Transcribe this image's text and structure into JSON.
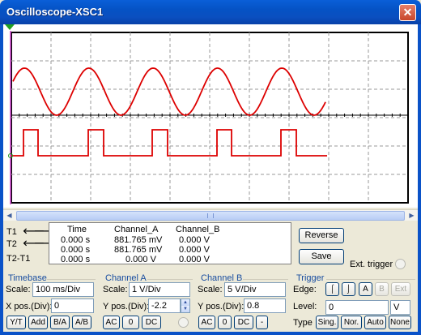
{
  "window": {
    "title": "Oscilloscope-XSC1",
    "close_label": "✕"
  },
  "screen": {
    "channel_a_color": "#dd0000",
    "channel_b_color": "#dd0000",
    "cursor1_color": "#d040d0",
    "cursor2_color": "#2020c0"
  },
  "readout": {
    "headers": {
      "time": "Time",
      "a": "Channel_A",
      "b": "Channel_B"
    },
    "rows": [
      {
        "label": "T1",
        "time": "0.000 s",
        "a": "881.765 mV",
        "b": "0.000 V"
      },
      {
        "label": "T2",
        "time": "0.000 s",
        "a": "881.765 mV",
        "b": "0.000 V"
      },
      {
        "label": "T2-T1",
        "time": "0.000 s",
        "a": "0.000 V",
        "b": "0.000 V"
      }
    ]
  },
  "buttons": {
    "reverse": "Reverse",
    "save": "Save",
    "ext_trigger": "Ext. trigger"
  },
  "timebase": {
    "title": "Timebase",
    "scale_label": "Scale:",
    "scale_value": "100 ms/Div",
    "xpos_label": "X pos.(Div):",
    "xpos_value": "0",
    "modes": [
      "Y/T",
      "Add",
      "B/A",
      "A/B"
    ]
  },
  "channel_a": {
    "title": "Channel A",
    "scale_label": "Scale:",
    "scale_value": "1  V/Div",
    "ypos_label": "Y pos.(Div):",
    "ypos_value": "-2.2",
    "coupling": [
      "AC",
      "0",
      "DC"
    ]
  },
  "channel_b": {
    "title": "Channel B",
    "scale_label": "Scale:",
    "scale_value": "5  V/Div",
    "ypos_label": "Y pos.(Div):",
    "ypos_value": "0.8",
    "coupling": [
      "AC",
      "0",
      "DC",
      "-"
    ]
  },
  "trigger": {
    "title": "Trigger",
    "edge_label": "Edge:",
    "level_label": "Level:",
    "level_value": "0",
    "level_unit": "V",
    "type_label": "Type",
    "sources": [
      "A",
      "B",
      "Ext"
    ],
    "types": [
      "Sing.",
      "Nor.",
      "Auto",
      "None"
    ]
  }
}
